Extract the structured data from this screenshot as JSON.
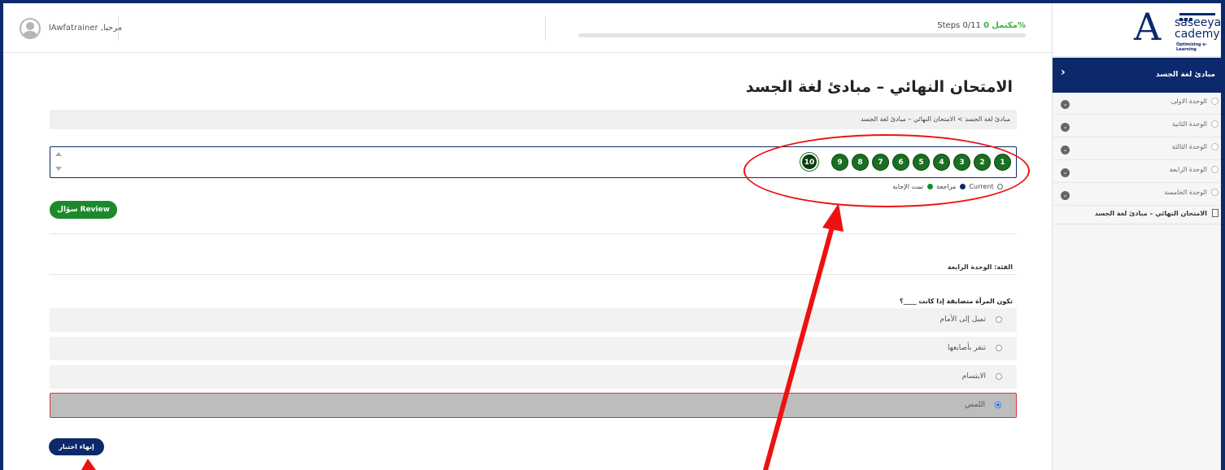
{
  "header": {
    "welcome": "مرحبا, lAwfatrainer",
    "progress_percent_label": "0%",
    "progress_complete_label": "مكتمل",
    "progress_steps": "Steps 0/11",
    "progress_value": 0
  },
  "logo": {
    "letter": "A",
    "line1": "saseeyat",
    "line2": "cademy",
    "tagline": "Optimizing e-Learning"
  },
  "sidebar": {
    "course_title": "مبادئ لغة الجسد",
    "units": [
      {
        "label": "الوحدة الاولى"
      },
      {
        "label": "الوحدة الثانية"
      },
      {
        "label": "الوحدة الثالثة"
      },
      {
        "label": "الوحدة الرابعة"
      },
      {
        "label": "الوحدة الخامسة"
      }
    ],
    "final_exam": "الامتحان النهائي – مبادئ لغة الجسد"
  },
  "main": {
    "title": "الامتحان النهائي – مبادئ لغة الجسد",
    "breadcrumb": "مبادئ لغة الجسد > الامتحان النهائي – مبادئ لغة الجسد",
    "question_numbers": [
      "1",
      "2",
      "3",
      "4",
      "5",
      "6",
      "7",
      "8",
      "9",
      "10"
    ],
    "legend": {
      "current": "Current",
      "review": "مراجعة",
      "answered": "تمت الإجابة"
    },
    "review_button": "Review سؤال",
    "category": "الفئة: الوحدة الرابعة",
    "question": "تكون المرأة متضايقة إذا كانت ____؟",
    "answers": [
      {
        "text": "تميل إلى الأمام",
        "selected": false
      },
      {
        "text": "تنقر بأصابعها",
        "selected": false
      },
      {
        "text": "الابتسام",
        "selected": false
      },
      {
        "text": "اللمس",
        "selected": true
      }
    ],
    "finish_button": "إنهاء اختبار"
  },
  "colors": {
    "brand_navy": "#0c2a6b",
    "question_green": "#1b6e22",
    "review_green": "#1b8a2b",
    "annotation_red": "#ee1111"
  }
}
